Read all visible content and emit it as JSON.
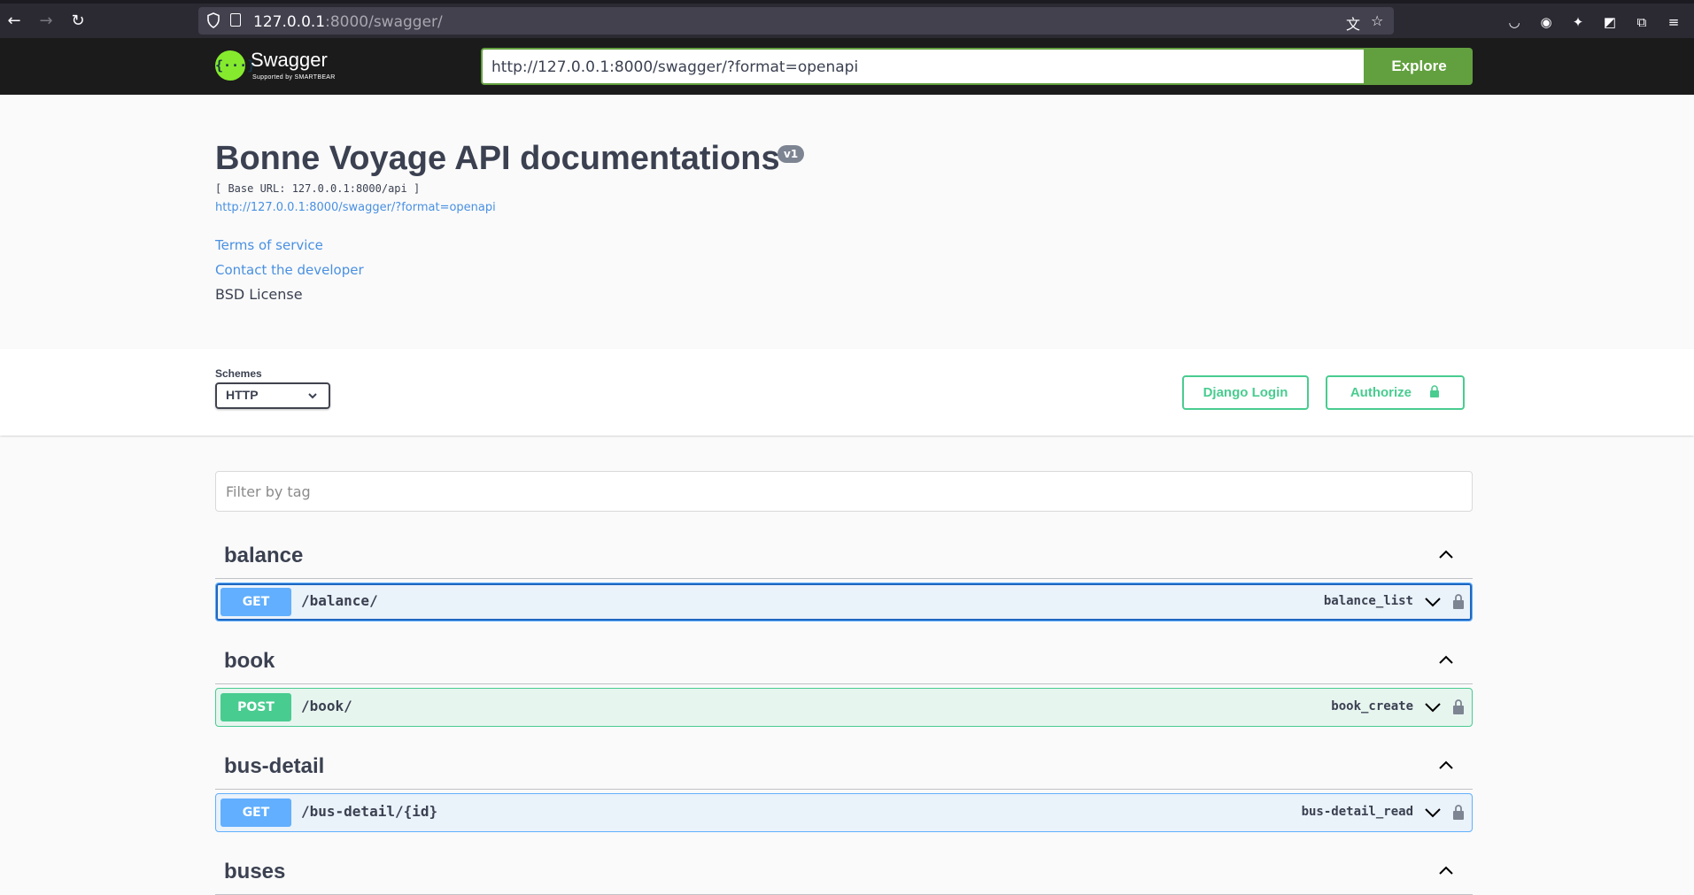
{
  "browser": {
    "url_host": "127.0.0.1",
    "url_rest": ":8000/swagger/"
  },
  "topbar": {
    "logo_text": "Swagger",
    "logo_sub": "Supported by SMARTBEAR",
    "logo_glyph": "{···}",
    "explore_url": "http://127.0.0.1:8000/swagger/?format=openapi",
    "explore_label": "Explore"
  },
  "info": {
    "title": "Bonne Voyage API documentations",
    "version": "v1",
    "base_url": "[ Base URL: 127.0.0.1:8000/api ]",
    "spec_url": "http://127.0.0.1:8000/swagger/?format=openapi",
    "terms": "Terms of service",
    "contact": "Contact the developer",
    "license": "BSD License"
  },
  "schemes": {
    "label": "Schemes",
    "selected": "HTTP",
    "django_login": "Django Login",
    "authorize": "Authorize"
  },
  "filter": {
    "placeholder": "Filter by tag"
  },
  "tags": [
    {
      "name": "balance",
      "op": {
        "method": "GET",
        "path": "/balance/",
        "id": "balance_list"
      }
    },
    {
      "name": "book",
      "op": {
        "method": "POST",
        "path": "/book/",
        "id": "book_create"
      }
    },
    {
      "name": "bus-detail",
      "op": {
        "method": "GET",
        "path": "/bus-detail/{id}",
        "id": "bus-detail_read"
      }
    },
    {
      "name": "buses"
    }
  ],
  "colors": {
    "get": "#61affe",
    "post": "#49cc90",
    "explore": "#62a03f",
    "topbar": "#1b1b1b"
  }
}
